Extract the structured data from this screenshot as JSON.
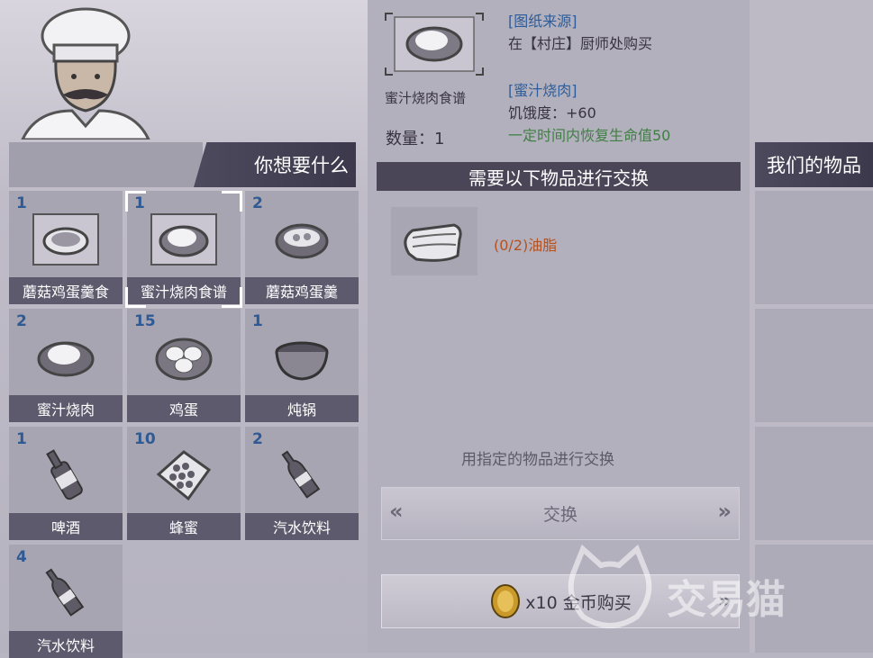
{
  "shop": {
    "header_left": "你想要什么",
    "header_right": "我们的物品",
    "items": [
      {
        "count": "1",
        "label": "蘑菇鸡蛋羹食",
        "icon": "recipe-mushroom-egg-icon"
      },
      {
        "count": "1",
        "label": "蜜汁烧肉食谱",
        "icon": "recipe-honey-meat-icon"
      },
      {
        "count": "2",
        "label": "蘑菇鸡蛋羹",
        "icon": "mushroom-egg-bowl-icon"
      },
      {
        "count": "2",
        "label": "蜜汁烧肉",
        "icon": "honey-meat-icon"
      },
      {
        "count": "15",
        "label": "鸡蛋",
        "icon": "eggs-icon"
      },
      {
        "count": "1",
        "label": "炖锅",
        "icon": "pot-icon"
      },
      {
        "count": "1",
        "label": "啤酒",
        "icon": "beer-bottle-icon"
      },
      {
        "count": "10",
        "label": "蜂蜜",
        "icon": "honeycomb-icon"
      },
      {
        "count": "2",
        "label": "汽水饮料",
        "icon": "soda-bottle-icon"
      },
      {
        "count": "4",
        "label": "汽水饮料",
        "icon": "soda-bottle-icon"
      }
    ]
  },
  "detail": {
    "item_name": "蜜汁烧肉食谱",
    "quantity": "数量：1",
    "source_title": "[图纸来源]",
    "source_text": "在【村庄】厨师处购买",
    "product_title": "[蜜汁烧肉]",
    "effect_hunger": "饥饿度：+60",
    "effect_heal": "一定时间内恢复生命值50",
    "exchange_header": "需要以下物品进行交换",
    "requirement": "(0/2)油脂",
    "exchange_hint": "用指定的物品进行交换",
    "exchange_button": "交换",
    "buy_button": "x10 金币购买"
  },
  "watermark": "交易猫",
  "colors": {
    "count_blue": "#2f5a94",
    "link_blue": "#2d5c98",
    "effect_green": "#3f7f43",
    "requirement_orange": "#b4511f",
    "header_dark": "#4a4658"
  }
}
